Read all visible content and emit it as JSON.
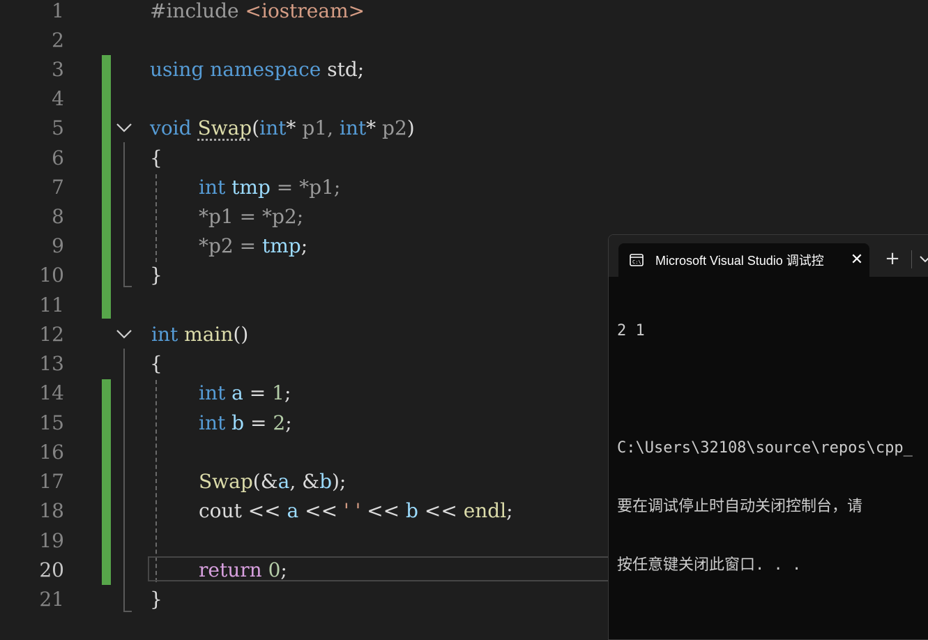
{
  "editor": {
    "current_line": 20,
    "lines": [
      {
        "n": "1"
      },
      {
        "n": "2"
      },
      {
        "n": "3"
      },
      {
        "n": "4"
      },
      {
        "n": "5"
      },
      {
        "n": "6"
      },
      {
        "n": "7"
      },
      {
        "n": "8"
      },
      {
        "n": "9"
      },
      {
        "n": "10"
      },
      {
        "n": "11"
      },
      {
        "n": "12"
      },
      {
        "n": "13"
      },
      {
        "n": "14"
      },
      {
        "n": "15"
      },
      {
        "n": "16"
      },
      {
        "n": "17"
      },
      {
        "n": "18"
      },
      {
        "n": "19"
      },
      {
        "n": "20"
      },
      {
        "n": "21"
      }
    ],
    "tokens": {
      "l1_pp": "#include",
      "l1_inc": "<iostream>",
      "l3_using": "using",
      "l3_namespace": "namespace",
      "l3_std": "std;",
      "l5_void": "void",
      "l5_swap": "Swap",
      "l5_open": "(",
      "l5_int1": "int",
      "l5_star1": "*",
      "l5_p1": "p1,",
      "l5_int2": "int",
      "l5_star2": "*",
      "l5_p2": "p2",
      "l5_close": ")",
      "l6_brace": "{",
      "l7_int": "int",
      "l7_tmp": "tmp",
      "l7_rest": " = *p1;",
      "l8_text": "*p1 = *p2;",
      "l9_lhs": "*p2 = ",
      "l9_tmp": "tmp",
      "l9_semi": ";",
      "l10_brace": "}",
      "l12_int": "int",
      "l12_main": "main",
      "l12_parens": "()",
      "l13_brace": "{",
      "l14_int": "int",
      "l14_a": "a",
      "l14_eq": " = ",
      "l14_one": "1",
      "l14_semi": ";",
      "l15_int": "int",
      "l15_b": "b",
      "l15_eq": " = ",
      "l15_two": "2",
      "l15_semi": ";",
      "l17_swap": "Swap",
      "l17_args1": "(&",
      "l17_a": "a",
      "l17_args2": ", &",
      "l17_b": "b",
      "l17_end": ");",
      "l18_cout": "cout << ",
      "l18_a": "a",
      "l18_op1": " << ",
      "l18_str": "' '",
      "l18_op2": " << ",
      "l18_b": "b",
      "l18_op3": " << ",
      "l18_endl": "endl",
      "l18_semi": ";",
      "l20_return": "return",
      "l20_zero": "0",
      "l20_semi": ";",
      "l21_brace": "}"
    },
    "colors": {
      "keyword": "#569cd6",
      "control": "#d8a0df",
      "function": "#dcdcaa",
      "variable": "#9cdcfe",
      "number": "#b5cea8",
      "string": "#d69d85",
      "change_bar": "#57a64a"
    }
  },
  "terminal": {
    "tab_title": "Microsoft Visual Studio 调试控",
    "tab_icon": "console-icon",
    "close_glyph": "✕",
    "new_tab_glyph": "+",
    "dropdown_icon": "chevron-down-icon",
    "output": [
      "2 1",
      "",
      "C:\\Users\\32108\\source\\repos\\cpp_",
      "要在调试停止时自动关闭控制台，请",
      "按任意键关闭此窗口. . ."
    ]
  }
}
